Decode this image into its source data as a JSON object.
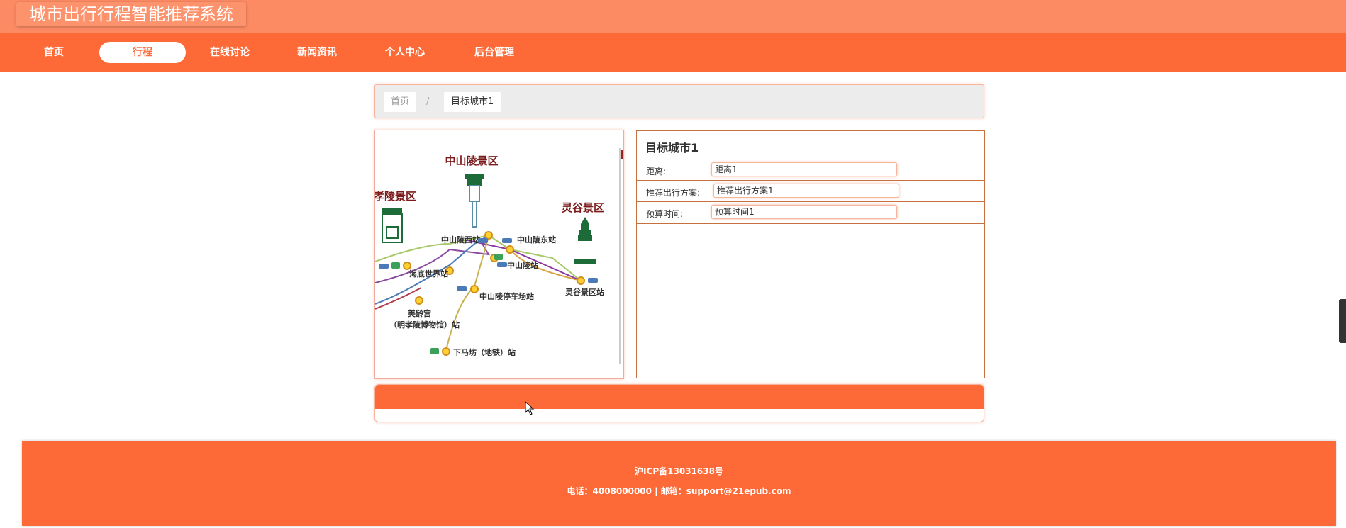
{
  "header": {
    "site_title": "城市出行行程智能推荐系统"
  },
  "nav": {
    "items": [
      {
        "label": "首页",
        "active": false
      },
      {
        "label": "行程",
        "active": true
      },
      {
        "label": "在线讨论",
        "active": false
      },
      {
        "label": "新闻资讯",
        "active": false
      },
      {
        "label": "个人中心",
        "active": false
      },
      {
        "label": "后台管理",
        "active": false
      }
    ]
  },
  "breadcrumb": {
    "home": "首页",
    "separator": "/",
    "current": "目标城市1"
  },
  "map": {
    "area_labels": [
      "中山陵景区",
      "灵谷景区",
      "孝陵景区"
    ],
    "station_labels": [
      "中山陵西站",
      "中山陵东站",
      "海底世界站",
      "中山陵站",
      "中山陵停车场站",
      "灵谷景区站",
      "美龄宫",
      "（明孝陵博物馆）站",
      "下马坊（地铁）站"
    ]
  },
  "detail": {
    "title": "目标城市1",
    "fields": [
      {
        "label": "距离:",
        "value": "距离1"
      },
      {
        "label": "推荐出行方案:",
        "value": "推荐出行方案1"
      },
      {
        "label": "预算时间:",
        "value": "预算时间1"
      }
    ]
  },
  "footer": {
    "icp": "沪ICP备13031638号",
    "contact": "电话：4008000000 | 邮箱：support@21epub.com"
  },
  "colors": {
    "primary": "#fd6a37",
    "topbar": "#fc8b63",
    "title_bg": "#fd936c",
    "breadcrumb_bg": "#ececec"
  }
}
